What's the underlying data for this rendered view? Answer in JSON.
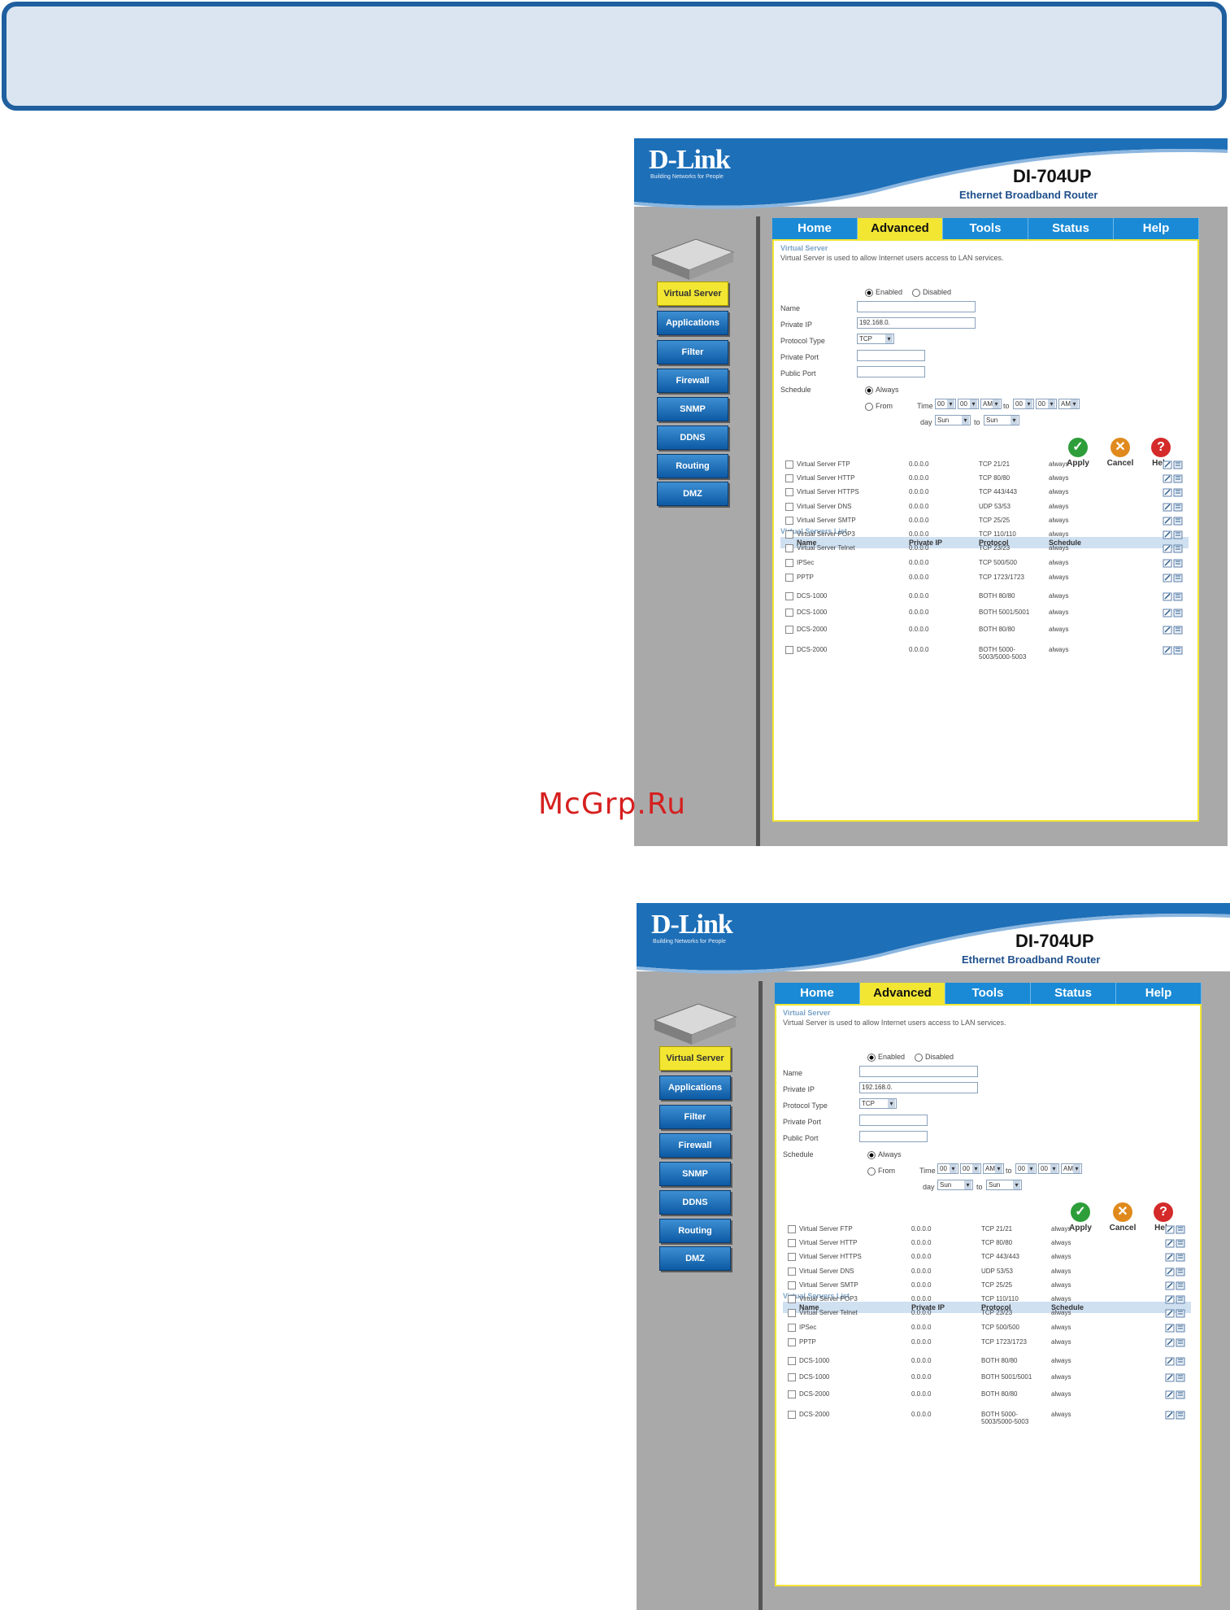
{
  "watermark": "McGrp.Ru",
  "shots": [
    {
      "id": "top"
    },
    {
      "id": "bottom"
    }
  ],
  "router": {
    "brand": "D-Link",
    "tagline": "Building Networks for People",
    "model": "DI-704UP",
    "subtitle": "Ethernet Broadband Router"
  },
  "sidebar": {
    "items": [
      "Virtual Server",
      "Applications",
      "Filter",
      "Firewall",
      "SNMP",
      "DDNS",
      "Routing",
      "DMZ"
    ],
    "active_index": 0
  },
  "tabs": {
    "items": [
      "Home",
      "Advanced",
      "Tools",
      "Status",
      "Help"
    ],
    "active_index": 1
  },
  "virtual_server": {
    "title": "Virtual Server",
    "description": "Virtual Server is used to allow Internet users access to LAN services.",
    "enabled_label": "Enabled",
    "disabled_label": "Disabled",
    "name_label": "Name",
    "private_ip_label": "Private IP",
    "private_ip_value": "192.168.0.",
    "protocol_label": "Protocol Type",
    "protocol_value": "TCP",
    "private_port_label": "Private Port",
    "public_port_label": "Public Port",
    "schedule_label": "Schedule",
    "always_label": "Always",
    "from_label": "From",
    "time_label": "Time",
    "time_from_h": "00",
    "time_from_m": "00",
    "time_from_ampm": "AM",
    "to_label": "to",
    "time_to_h": "00",
    "time_to_m": "00",
    "time_to_ampm": "AM",
    "day_label": "day",
    "day_from": "Sun",
    "day_to": "Sun"
  },
  "actions": {
    "apply": "Apply",
    "cancel": "Cancel",
    "help": "Help"
  },
  "list": {
    "title": "Virtual Servers List",
    "columns": [
      "Name",
      "Private IP",
      "Protocol",
      "Schedule"
    ],
    "rows": [
      {
        "name": "Virtual Server FTP",
        "ip": "0.0.0.0",
        "protocol": "TCP 21/21",
        "schedule": "always"
      },
      {
        "name": "Virtual Server HTTP",
        "ip": "0.0.0.0",
        "protocol": "TCP 80/80",
        "schedule": "always"
      },
      {
        "name": "Virtual Server HTTPS",
        "ip": "0.0.0.0",
        "protocol": "TCP 443/443",
        "schedule": "always"
      },
      {
        "name": "Virtual Server DNS",
        "ip": "0.0.0.0",
        "protocol": "UDP 53/53",
        "schedule": "always"
      },
      {
        "name": "Virtual Server SMTP",
        "ip": "0.0.0.0",
        "protocol": "TCP 25/25",
        "schedule": "always"
      },
      {
        "name": "Virtual Server POP3",
        "ip": "0.0.0.0",
        "protocol": "TCP 110/110",
        "schedule": "always"
      },
      {
        "name": "Virtual Server Telnet",
        "ip": "0.0.0.0",
        "protocol": "TCP 23/23",
        "schedule": "always"
      },
      {
        "name": "IPSec",
        "ip": "0.0.0.0",
        "protocol": "TCP 500/500",
        "schedule": "always"
      },
      {
        "name": "PPTP",
        "ip": "0.0.0.0",
        "protocol": "TCP 1723/1723",
        "schedule": "always"
      },
      {
        "name": "DCS-1000",
        "ip": "0.0.0.0",
        "protocol": "BOTH 80/80",
        "schedule": "always"
      },
      {
        "name": "DCS-1000",
        "ip": "0.0.0.0",
        "protocol": "BOTH 5001/5001",
        "schedule": "always"
      },
      {
        "name": "DCS-2000",
        "ip": "0.0.0.0",
        "protocol": "BOTH 80/80",
        "schedule": "always"
      },
      {
        "name": "DCS-2000",
        "ip": "0.0.0.0",
        "protocol": "BOTH 5000-5003/5000-5003",
        "schedule": "always"
      }
    ]
  },
  "colors": {
    "accent_blue": "#1a8ad6",
    "active_yellow": "#f2e633",
    "banner_border": "#1f5f9f",
    "banner_fill": "#dbe5f1",
    "watermark_red": "#d61f1f"
  }
}
